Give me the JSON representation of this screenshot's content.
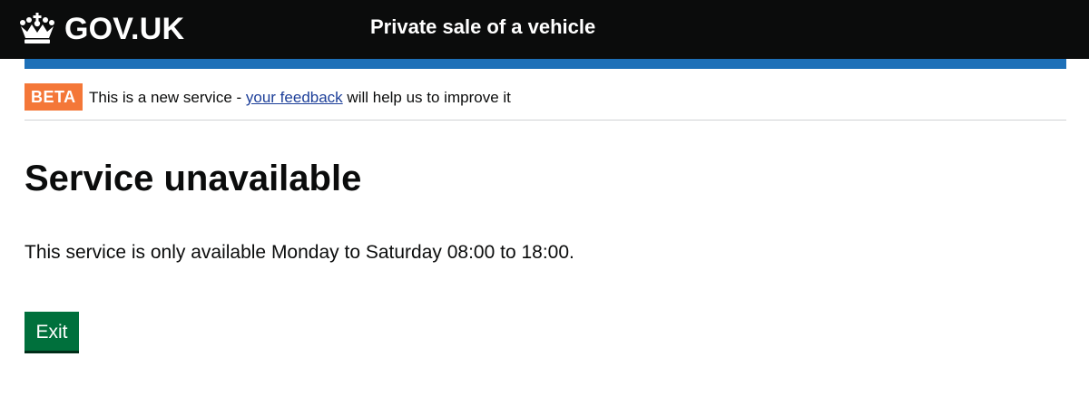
{
  "header": {
    "logo_text": "GOV.UK",
    "logo_icon": "crown-icon",
    "service_name": "Private sale of a vehicle",
    "background_color": "#0b0c0c",
    "accent_bar_color": "#1d70b8"
  },
  "phase_banner": {
    "tag": "BETA",
    "tag_color": "#f47738",
    "text_before": "This is a new service - ",
    "link_text": "your feedback",
    "text_after": " will help us to improve it"
  },
  "main": {
    "title": "Service unavailable",
    "body": "This service is only available Monday to Saturday 08:00 to 18:00.",
    "exit_button_label": "Exit",
    "exit_button_color": "#00703c"
  }
}
